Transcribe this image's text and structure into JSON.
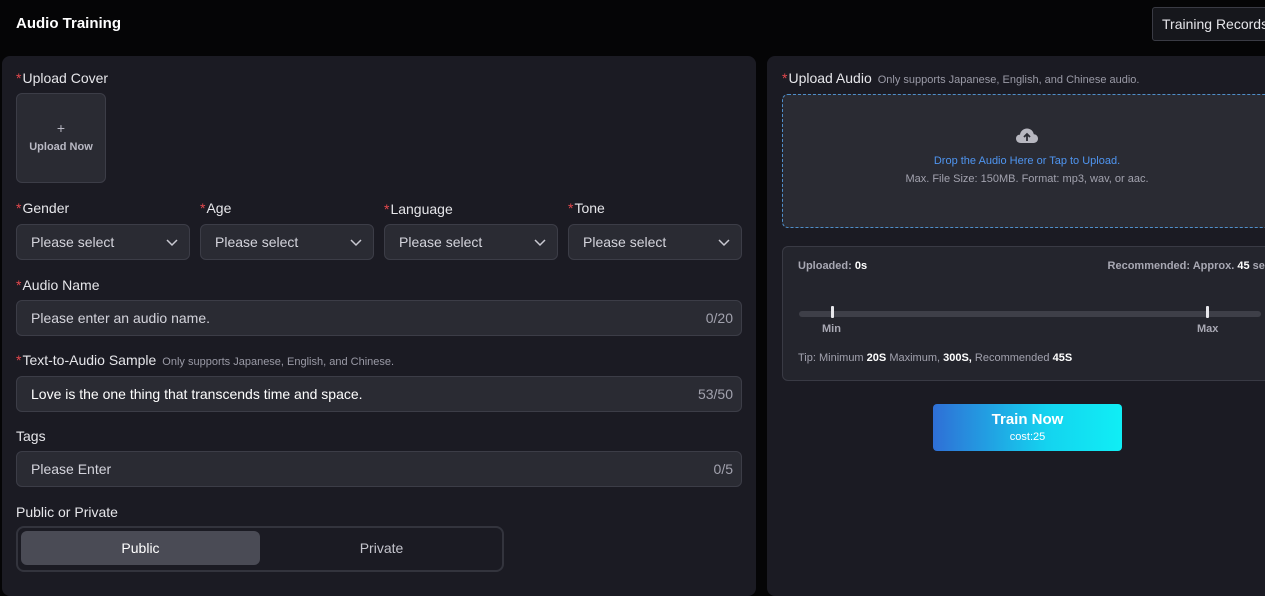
{
  "header": {
    "title": "Audio Training",
    "records_button": "Training Records"
  },
  "left": {
    "upload_cover": {
      "label": "Upload Cover",
      "plus": "+",
      "button": "Upload Now"
    },
    "selects": [
      {
        "label": "Gender",
        "placeholder": "Please select"
      },
      {
        "label": "Age",
        "placeholder": "Please select"
      },
      {
        "label": "Language",
        "placeholder": "Please select"
      },
      {
        "label": "Tone",
        "placeholder": "Please select"
      }
    ],
    "audio_name": {
      "label": "Audio Name",
      "placeholder": "Please enter an audio name.",
      "count": "0/20"
    },
    "sample": {
      "label": "Text-to-Audio Sample",
      "hint": "Only supports Japanese, English, and Chinese.",
      "value": "Love is the one thing that transcends time and space.",
      "count": "53/50"
    },
    "tags": {
      "label": "Tags",
      "placeholder": "Please Enter",
      "count": "0/5"
    },
    "visibility": {
      "label": "Public or Private",
      "options": [
        "Public",
        "Private"
      ],
      "selected": "Public"
    }
  },
  "right": {
    "upload_audio": {
      "label": "Upload Audio",
      "hint": "Only supports Japanese, English, and Chinese audio.",
      "drop_text": "Drop the Audio Here or Tap to Upload.",
      "limits": "Max. File Size: 150MB. Format: mp3, wav, or aac."
    },
    "duration": {
      "uploaded_label": "Uploaded:",
      "uploaded_value": "0s",
      "recommended_label": "Recommended: Approx.",
      "recommended_value": "45",
      "recommended_unit": "sec",
      "min_label": "Min",
      "max_label": "Max",
      "tip_prefix": "Tip: Minimum",
      "tip_min": "20S",
      "tip_max_label": "Maximum,",
      "tip_max": "300S,",
      "tip_rec_label": "Recommended",
      "tip_rec": "45S"
    },
    "train_button": {
      "label": "Train Now",
      "cost": "cost:25"
    }
  },
  "colors": {
    "required": "#e5484d",
    "accent_blue": "#4f95f0",
    "gradient_start": "#2f6fd6",
    "gradient_end": "#10eef5"
  }
}
